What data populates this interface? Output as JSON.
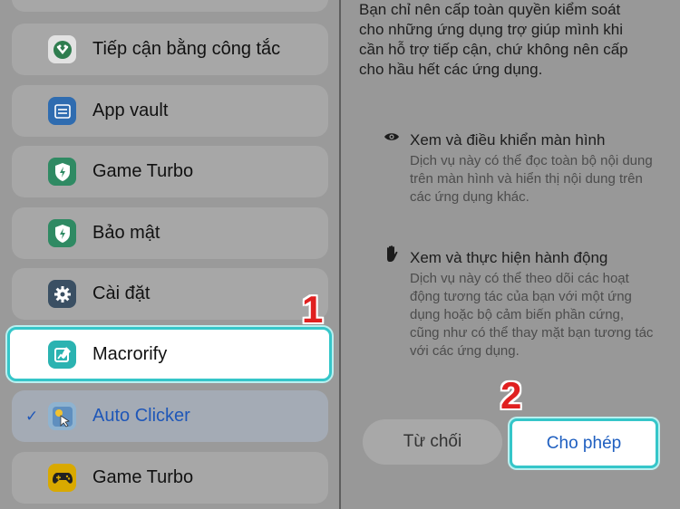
{
  "list": {
    "items": [
      {
        "label": "Tiếp cận bằng công tắc",
        "icon": "switch-access-icon"
      },
      {
        "label": "App vault",
        "icon": "app-vault-icon"
      },
      {
        "label": "Game Turbo",
        "icon": "shield-bolt-icon"
      },
      {
        "label": "Bảo mật",
        "icon": "shield-bolt-icon"
      },
      {
        "label": "Cài đặt",
        "icon": "gear-icon"
      },
      {
        "label": "Macrorify",
        "icon": "macrorify-icon"
      },
      {
        "label": "Auto Clicker",
        "icon": "auto-clicker-icon",
        "check": "✓"
      },
      {
        "label": "Game Turbo",
        "icon": "gamepad-icon"
      }
    ]
  },
  "badges": {
    "step1": "1",
    "step2": "2"
  },
  "dialog": {
    "intro": "Bạn chỉ nên cấp toàn quyền kiểm soát cho những ứng dụng trợ giúp mình khi cần hỗ trợ tiếp cận, chứ không nên cấp cho hầu hết các ứng dụng.",
    "permissions": [
      {
        "title": "Xem và điều khiển màn hình",
        "description": "Dịch vụ này có thể đọc toàn bộ nội dung trên màn hình và hiển thị nội dung trên các ứng dụng khác.",
        "icon": "eye-icon"
      },
      {
        "title": "Xem và thực hiện hành động",
        "description": "Dịch vụ này có thể theo dõi các hoạt động tương tác của bạn với một ứng dụng hoặc bộ cảm biến phần cứng, cũng như có thể thay mặt bạn tương tác với các ứng dụng.",
        "icon": "hand-icon"
      }
    ],
    "deny_label": "Từ chối",
    "allow_label": "Cho phép"
  },
  "colors": {
    "highlight_border": "#35c6c9",
    "selected_text": "#1f57b8",
    "badge_red": "#e02020",
    "allow_text": "#1f5fc0"
  }
}
